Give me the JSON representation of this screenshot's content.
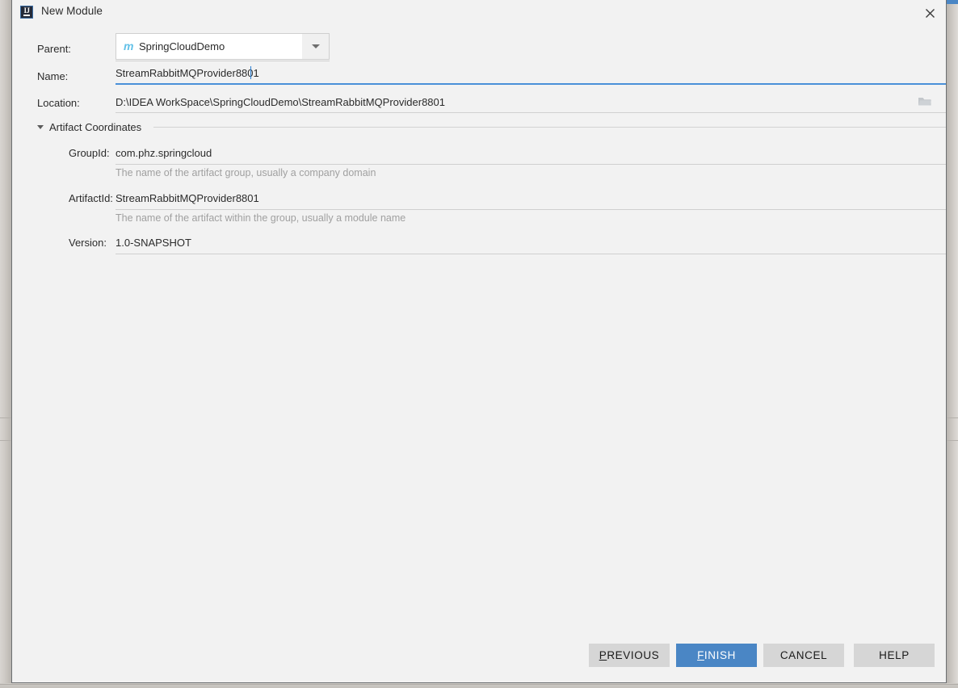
{
  "window": {
    "title": "New Module",
    "icon": "intellij-idea-icon",
    "close_label": "✕"
  },
  "form": {
    "parent": {
      "label": "Parent:",
      "value": "SpringCloudDemo",
      "icon": "maven-module-icon",
      "dropdown_icon": "chevron-down-icon"
    },
    "name": {
      "label": "Name:",
      "value": "StreamRabbitMQProvider8801",
      "placeholder": ""
    },
    "location": {
      "label": "Location:",
      "value": "D:\\IDEA WorkSpace\\SpringCloudDemo\\StreamRabbitMQProvider8801",
      "browse_icon": "folder-icon"
    },
    "artifact_coordinates": {
      "section_title": "Artifact Coordinates",
      "expanded": true,
      "fields": [
        {
          "label": "GroupId:",
          "value": "com.phz.springcloud",
          "hint": "The name of the artifact group, usually a company domain"
        },
        {
          "label": "ArtifactId:",
          "value": "StreamRabbitMQProvider8801",
          "hint": "The name of the artifact within the group, usually a module name"
        },
        {
          "label": "Version:",
          "value": "1.0-SNAPSHOT",
          "hint": ""
        }
      ]
    }
  },
  "footer": {
    "buttons": [
      {
        "label": "PREVIOUS",
        "mnemonic": "P",
        "primary": false
      },
      {
        "label": "FINISH",
        "mnemonic": "F",
        "primary": true
      },
      {
        "label": "CANCEL",
        "mnemonic": "",
        "primary": false
      },
      {
        "label": "HELP",
        "mnemonic": "",
        "primary": false
      }
    ],
    "previous": {
      "pre": "",
      "mn": "P",
      "post": "REVIOUS"
    },
    "finish": {
      "pre": "",
      "mn": "F",
      "post": "INISH"
    },
    "cancel": {
      "pre": "CANCEL",
      "mn": "",
      "post": ""
    },
    "help": {
      "pre": "HELP",
      "mn": "",
      "post": ""
    }
  },
  "colors": {
    "accent_blue": "#4a86c5",
    "focus_underline": "#4a90d9",
    "maven_icon": "#62c1e8",
    "dialog_bg": "#f2f2f2",
    "button_bg": "#d6d6d6",
    "hint_text": "#a0a0a0"
  }
}
